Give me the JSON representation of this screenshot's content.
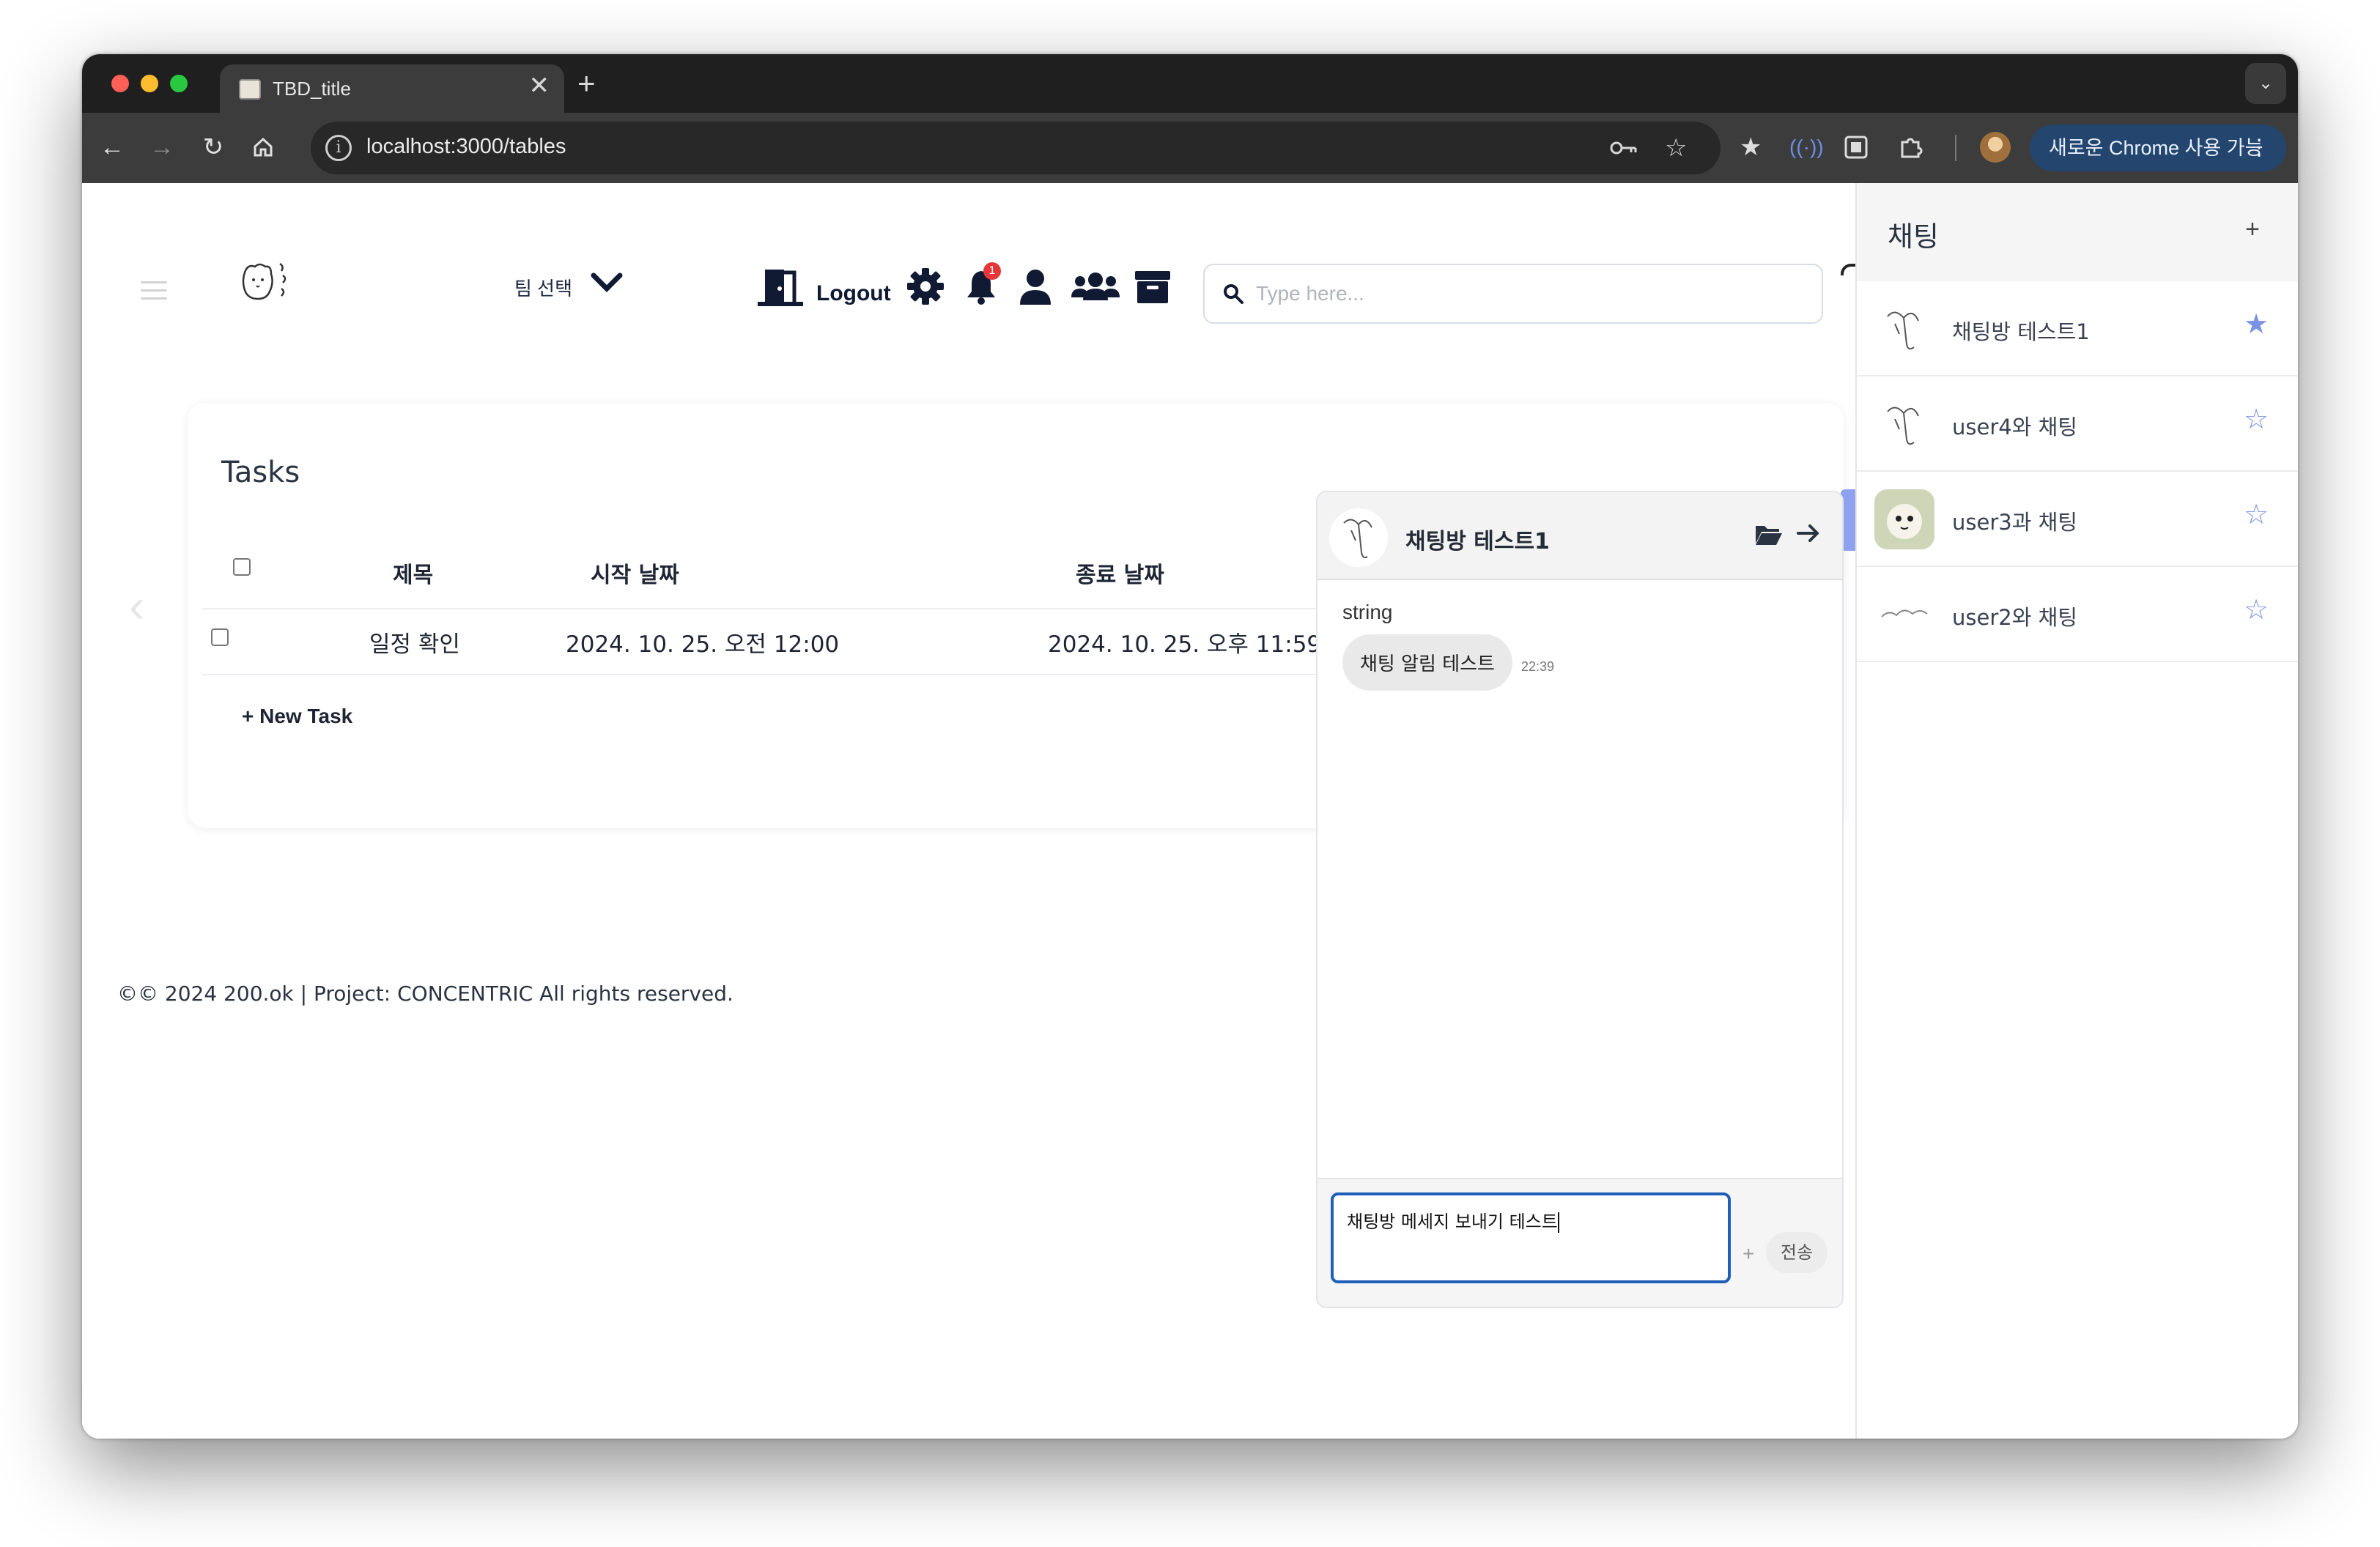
{
  "browser": {
    "tab_title": "TBD_title",
    "tab_close": "✕",
    "new_tab": "+",
    "url": "localhost:3000/tables",
    "update_button": "새로운 Chrome 사용 가능",
    "colors": {
      "frame": "#1f1f1f",
      "toolbar": "#3c3c3c",
      "update_button": "#24466e"
    }
  },
  "header": {
    "team_select_label": "팀 선택",
    "logout_label": "Logout",
    "notification_count": "1",
    "search_placeholder": "Type here..."
  },
  "tasks": {
    "title": "Tasks",
    "columns": [
      "제목",
      "시작 날짜",
      "종료 날짜"
    ],
    "rows": [
      {
        "title": "일정 확인",
        "start": "2024. 10. 25. 오전 12:00",
        "end": "2024. 10. 25. 오후 11:59"
      }
    ],
    "new_task_label": "+ New Task"
  },
  "footer": {
    "text": "©© 2024 200.ok | Project: CONCENTRIC All rights reserved."
  },
  "chat_window": {
    "room_name": "채팅방 테스트1",
    "messages": [
      {
        "sender": "string",
        "text": "채팅 알림 테스트",
        "time": "22:39"
      }
    ],
    "input_value": "채팅방 메세지 보내기 테스트",
    "attach_label": "+",
    "send_label": "전송",
    "colors": {
      "input_border": "#1f5fb8"
    }
  },
  "chat_sidebar": {
    "title": "채팅",
    "add_label": "+",
    "rooms": [
      {
        "name": "채팅방 테스트1",
        "favorite": true,
        "star": "★"
      },
      {
        "name": "user4와 채팅",
        "favorite": false,
        "star": "☆"
      },
      {
        "name": "user3과 채팅",
        "favorite": false,
        "star": "☆"
      },
      {
        "name": "user2와 채팅",
        "favorite": false,
        "star": "☆"
      }
    ],
    "colors": {
      "star": "#7b93e6"
    }
  }
}
